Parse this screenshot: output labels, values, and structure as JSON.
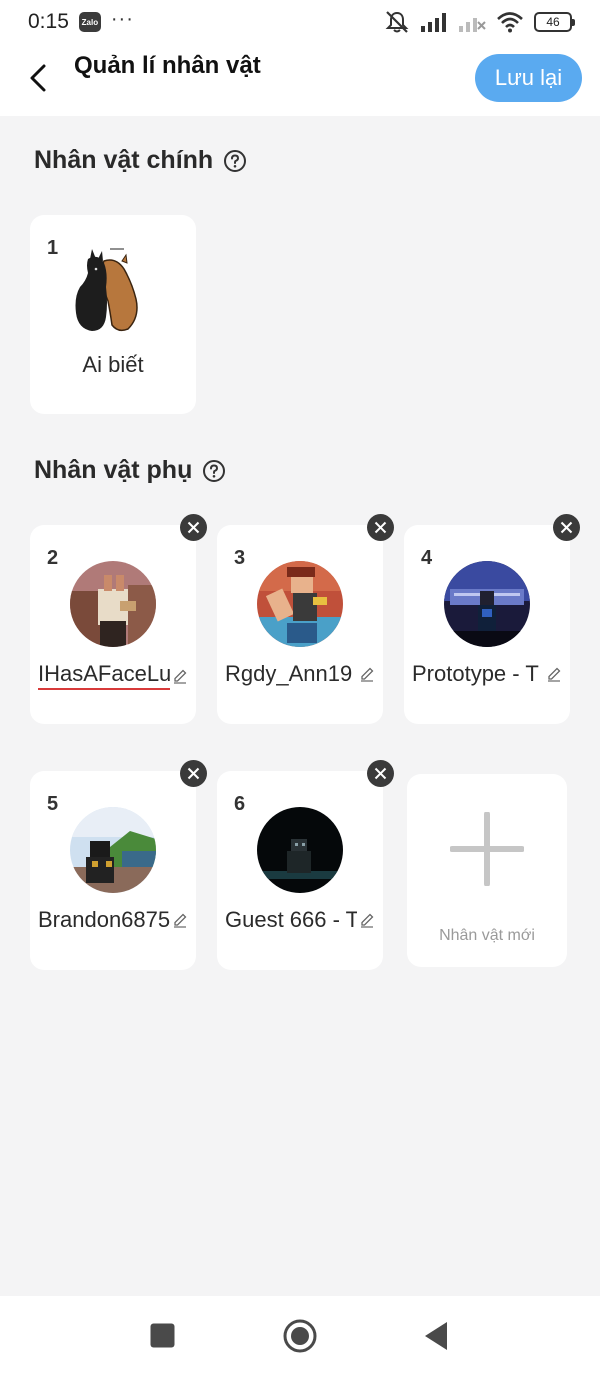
{
  "status_bar": {
    "time": "0:15",
    "app_badge": "Zalo",
    "more": "···",
    "battery": "46"
  },
  "header": {
    "title": "Quản lí nhân vật",
    "save_label": "Lưu lại"
  },
  "colors": {
    "accent": "#5aaaf0",
    "background": "#f4f4f5",
    "card": "#ffffff",
    "spellcheck": "#d83a3a"
  },
  "main_section": {
    "title": "Nhân vật chính",
    "character": {
      "index": "1",
      "name": "Ai biết",
      "icon": "two-horses-avatar"
    }
  },
  "side_section": {
    "title": "Nhân vật phụ",
    "characters": [
      {
        "index": "2",
        "name": "IHasAFaceLu",
        "icon": "roblox-avatar"
      },
      {
        "index": "3",
        "name": "Rgdy_Ann19",
        "icon": "roblox-avatar"
      },
      {
        "index": "4",
        "name": "Prototype - T",
        "icon": "roblox-avatar"
      },
      {
        "index": "5",
        "name": "Brandon6875",
        "icon": "roblox-avatar"
      },
      {
        "index": "6",
        "name": "Guest 666 - T",
        "icon": "roblox-avatar"
      }
    ],
    "new_label": "Nhân vật mới"
  }
}
